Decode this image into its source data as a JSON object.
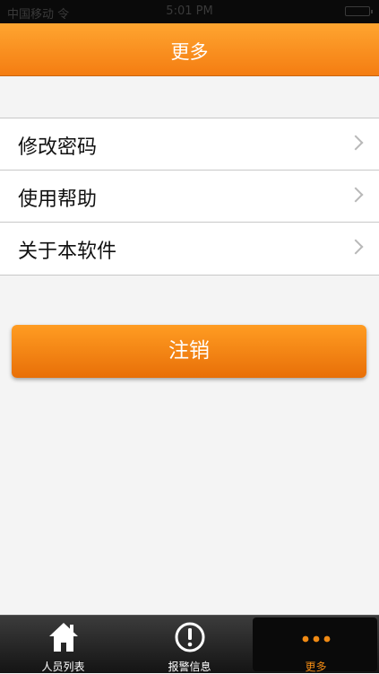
{
  "status_bar": {
    "carrier": "中国移动 令",
    "time": "5:01 PM"
  },
  "nav": {
    "title": "更多"
  },
  "menu": {
    "items": [
      {
        "label": "修改密码"
      },
      {
        "label": "使用帮助"
      },
      {
        "label": "关于本软件"
      }
    ]
  },
  "logout": {
    "label": "注销"
  },
  "tab_bar": {
    "tabs": [
      {
        "label": "人员列表",
        "icon": "home-icon"
      },
      {
        "label": "报警信息",
        "icon": "alert-icon"
      },
      {
        "label": "更多",
        "icon": "more-dots-icon",
        "active": true
      }
    ]
  },
  "colors": {
    "accent": "#f47d12",
    "tab_active": "#f08a14"
  }
}
